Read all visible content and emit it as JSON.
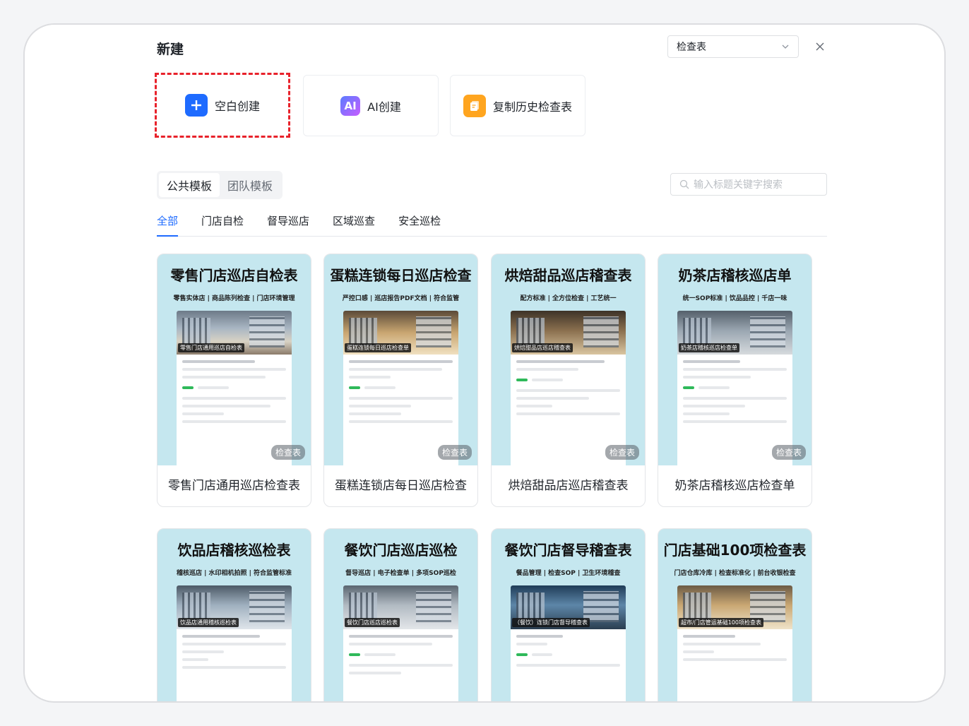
{
  "dialog": {
    "title": "新建",
    "type_select": "检查表"
  },
  "create_options": [
    {
      "label": "空白创建",
      "icon": "plus-icon"
    },
    {
      "label": "AI创建",
      "icon": "ai-icon",
      "icon_text": "AI"
    },
    {
      "label": "复制历史检查表",
      "icon": "copy-icon"
    }
  ],
  "template_scope": {
    "public": "公共模板",
    "team": "团队模板"
  },
  "search": {
    "placeholder": "输入标题关键字搜索"
  },
  "category_tabs": [
    "全部",
    "门店自检",
    "督导巡店",
    "区域巡查",
    "安全巡检"
  ],
  "badge_label": "检查表",
  "templates": [
    {
      "heading": "零售门店巡店自检表",
      "sub": "零售实体店 | 商品陈列检查 | 门店环境管理",
      "caption": "零售门店通用巡店自检表",
      "name": "零售门店通用巡店检查表"
    },
    {
      "heading": "蛋糕连锁每日巡店检查",
      "sub": "严控口感 | 巡店报告PDF文档 | 符合监管",
      "caption": "蛋糕连锁每日巡店检查单",
      "name": "蛋糕连锁店每日巡店检查"
    },
    {
      "heading": "烘焙甜品巡店稽查表",
      "sub": "配方标准 | 全方位检查 | 工艺统一",
      "caption": "烘焙甜品店巡店稽查表",
      "name": "烘焙甜品店巡店稽查表"
    },
    {
      "heading": "奶茶店稽核巡店单",
      "sub": "统一SOP标准 | 饮品品控 | 千店一味",
      "caption": "奶茶店稽核巡店检查单",
      "name": "奶茶店稽核巡店检查单"
    },
    {
      "heading": "饮品店稽核巡检表",
      "sub": "稽核巡店 | 水印相机拍照 | 符合监管标准",
      "caption": "饮品店通用稽核巡检表"
    },
    {
      "heading": "餐饮门店巡店巡检",
      "sub": "督导巡店 | 电子检查单 | 多项SOP巡检",
      "caption": "餐饮门店巡店巡检表"
    },
    {
      "heading": "餐饮门店督导稽查表",
      "sub": "餐品管理 | 检查SOP | 卫生环境稽查",
      "caption": "（餐饮）连锁门店督导稽查表"
    },
    {
      "heading": "门店基础100项检查表",
      "sub": "门店仓库冷库 | 检查标准化 | 前台收银检查",
      "caption": "超市/门店管运基础100项检查表"
    }
  ],
  "colors": {
    "accent": "#1e6bff",
    "highlight_border": "#e8222b",
    "thumb_bg": "#c5e7ef"
  }
}
